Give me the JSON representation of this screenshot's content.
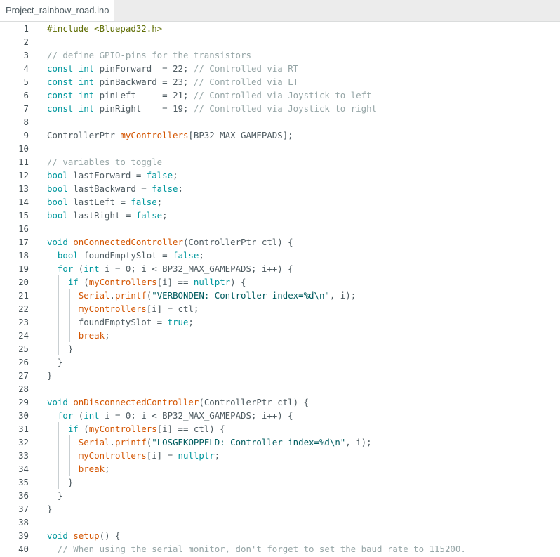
{
  "tab": {
    "filename": "Project_rainbow_road.ino"
  },
  "code": {
    "lines": [
      {
        "n": "1",
        "indent": 0,
        "tokens": [
          [
            "pp",
            "#include <Bluepad32.h>"
          ]
        ]
      },
      {
        "n": "2",
        "indent": 0,
        "tokens": []
      },
      {
        "n": "3",
        "indent": 0,
        "tokens": [
          [
            "cm",
            "// define GPIO-pins for the transistors"
          ]
        ]
      },
      {
        "n": "4",
        "indent": 0,
        "tokens": [
          [
            "kw",
            "const"
          ],
          [
            "tx",
            " "
          ],
          [
            "kw",
            "int"
          ],
          [
            "tx",
            " pinForward  = 22; "
          ],
          [
            "cm",
            "// Controlled via RT"
          ]
        ]
      },
      {
        "n": "5",
        "indent": 0,
        "tokens": [
          [
            "kw",
            "const"
          ],
          [
            "tx",
            " "
          ],
          [
            "kw",
            "int"
          ],
          [
            "tx",
            " pinBackward = 23; "
          ],
          [
            "cm",
            "// Controlled via LT"
          ]
        ]
      },
      {
        "n": "6",
        "indent": 0,
        "tokens": [
          [
            "kw",
            "const"
          ],
          [
            "tx",
            " "
          ],
          [
            "kw",
            "int"
          ],
          [
            "tx",
            " pinLeft     = 21; "
          ],
          [
            "cm",
            "// Controlled via Joystick to left"
          ]
        ]
      },
      {
        "n": "7",
        "indent": 0,
        "tokens": [
          [
            "kw",
            "const"
          ],
          [
            "tx",
            " "
          ],
          [
            "kw",
            "int"
          ],
          [
            "tx",
            " pinRight    = 19; "
          ],
          [
            "cm",
            "// Controlled via Joystick to right"
          ]
        ]
      },
      {
        "n": "8",
        "indent": 0,
        "tokens": []
      },
      {
        "n": "9",
        "indent": 0,
        "tokens": [
          [
            "tx",
            "ControllerPtr "
          ],
          [
            "fn",
            "myControllers"
          ],
          [
            "tx",
            "[BP32_MAX_GAMEPADS];"
          ]
        ]
      },
      {
        "n": "10",
        "indent": 0,
        "tokens": []
      },
      {
        "n": "11",
        "indent": 0,
        "tokens": [
          [
            "cm",
            "// variables to toggle"
          ]
        ]
      },
      {
        "n": "12",
        "indent": 0,
        "tokens": [
          [
            "kw",
            "bool"
          ],
          [
            "tx",
            " lastForward = "
          ],
          [
            "lt",
            "false"
          ],
          [
            "tx",
            ";"
          ]
        ]
      },
      {
        "n": "13",
        "indent": 0,
        "tokens": [
          [
            "kw",
            "bool"
          ],
          [
            "tx",
            " lastBackward = "
          ],
          [
            "lt",
            "false"
          ],
          [
            "tx",
            ";"
          ]
        ]
      },
      {
        "n": "14",
        "indent": 0,
        "tokens": [
          [
            "kw",
            "bool"
          ],
          [
            "tx",
            " lastLeft = "
          ],
          [
            "lt",
            "false"
          ],
          [
            "tx",
            ";"
          ]
        ]
      },
      {
        "n": "15",
        "indent": 0,
        "tokens": [
          [
            "kw",
            "bool"
          ],
          [
            "tx",
            " lastRight = "
          ],
          [
            "lt",
            "false"
          ],
          [
            "tx",
            ";"
          ]
        ]
      },
      {
        "n": "16",
        "indent": 0,
        "tokens": []
      },
      {
        "n": "17",
        "indent": 0,
        "tokens": [
          [
            "kw",
            "void"
          ],
          [
            "tx",
            " "
          ],
          [
            "fn",
            "onConnectedController"
          ],
          [
            "tx",
            "(ControllerPtr ctl) {"
          ]
        ]
      },
      {
        "n": "18",
        "indent": 1,
        "tokens": [
          [
            "tx",
            "  "
          ],
          [
            "kw",
            "bool"
          ],
          [
            "tx",
            " foundEmptySlot = "
          ],
          [
            "lt",
            "false"
          ],
          [
            "tx",
            ";"
          ]
        ]
      },
      {
        "n": "19",
        "indent": 1,
        "tokens": [
          [
            "tx",
            "  "
          ],
          [
            "kw",
            "for"
          ],
          [
            "tx",
            " ("
          ],
          [
            "kw",
            "int"
          ],
          [
            "tx",
            " i = 0; i < BP32_MAX_GAMEPADS; i++) {"
          ]
        ]
      },
      {
        "n": "20",
        "indent": 2,
        "tokens": [
          [
            "tx",
            "    "
          ],
          [
            "kw",
            "if"
          ],
          [
            "tx",
            " ("
          ],
          [
            "fn",
            "myControllers"
          ],
          [
            "tx",
            "[i] == "
          ],
          [
            "lt",
            "nullptr"
          ],
          [
            "tx",
            ") {"
          ]
        ]
      },
      {
        "n": "21",
        "indent": 3,
        "tokens": [
          [
            "tx",
            "      "
          ],
          [
            "fn",
            "Serial"
          ],
          [
            "tx",
            "."
          ],
          [
            "fn",
            "printf"
          ],
          [
            "tx",
            "("
          ],
          [
            "st",
            "\"VERBONDEN: Controller index=%d\\n\""
          ],
          [
            "tx",
            ", i);"
          ]
        ]
      },
      {
        "n": "22",
        "indent": 3,
        "tokens": [
          [
            "tx",
            "      "
          ],
          [
            "fn",
            "myControllers"
          ],
          [
            "tx",
            "[i] = ctl;"
          ]
        ]
      },
      {
        "n": "23",
        "indent": 3,
        "tokens": [
          [
            "tx",
            "      foundEmptySlot = "
          ],
          [
            "lt",
            "true"
          ],
          [
            "tx",
            ";"
          ]
        ]
      },
      {
        "n": "24",
        "indent": 3,
        "tokens": [
          [
            "tx",
            "      "
          ],
          [
            "fn",
            "break"
          ],
          [
            "tx",
            ";"
          ]
        ]
      },
      {
        "n": "25",
        "indent": 2,
        "tokens": [
          [
            "tx",
            "    }"
          ]
        ]
      },
      {
        "n": "26",
        "indent": 1,
        "tokens": [
          [
            "tx",
            "  }"
          ]
        ]
      },
      {
        "n": "27",
        "indent": 0,
        "tokens": [
          [
            "tx",
            "}"
          ]
        ]
      },
      {
        "n": "28",
        "indent": 0,
        "tokens": []
      },
      {
        "n": "29",
        "indent": 0,
        "tokens": [
          [
            "kw",
            "void"
          ],
          [
            "tx",
            " "
          ],
          [
            "fn",
            "onDisconnectedController"
          ],
          [
            "tx",
            "(ControllerPtr ctl) {"
          ]
        ]
      },
      {
        "n": "30",
        "indent": 1,
        "tokens": [
          [
            "tx",
            "  "
          ],
          [
            "kw",
            "for"
          ],
          [
            "tx",
            " ("
          ],
          [
            "kw",
            "int"
          ],
          [
            "tx",
            " i = 0; i < BP32_MAX_GAMEPADS; i++) {"
          ]
        ]
      },
      {
        "n": "31",
        "indent": 2,
        "tokens": [
          [
            "tx",
            "    "
          ],
          [
            "kw",
            "if"
          ],
          [
            "tx",
            " ("
          ],
          [
            "fn",
            "myControllers"
          ],
          [
            "tx",
            "[i] == ctl) {"
          ]
        ]
      },
      {
        "n": "32",
        "indent": 3,
        "tokens": [
          [
            "tx",
            "      "
          ],
          [
            "fn",
            "Serial"
          ],
          [
            "tx",
            "."
          ],
          [
            "fn",
            "printf"
          ],
          [
            "tx",
            "("
          ],
          [
            "st",
            "\"LOSGEKOPPELD: Controller index=%d\\n\""
          ],
          [
            "tx",
            ", i);"
          ]
        ]
      },
      {
        "n": "33",
        "indent": 3,
        "tokens": [
          [
            "tx",
            "      "
          ],
          [
            "fn",
            "myControllers"
          ],
          [
            "tx",
            "[i] = "
          ],
          [
            "lt",
            "nullptr"
          ],
          [
            "tx",
            ";"
          ]
        ]
      },
      {
        "n": "34",
        "indent": 3,
        "tokens": [
          [
            "tx",
            "      "
          ],
          [
            "fn",
            "break"
          ],
          [
            "tx",
            ";"
          ]
        ]
      },
      {
        "n": "35",
        "indent": 2,
        "tokens": [
          [
            "tx",
            "    }"
          ]
        ]
      },
      {
        "n": "36",
        "indent": 1,
        "tokens": [
          [
            "tx",
            "  }"
          ]
        ]
      },
      {
        "n": "37",
        "indent": 0,
        "tokens": [
          [
            "tx",
            "}"
          ]
        ]
      },
      {
        "n": "38",
        "indent": 0,
        "tokens": []
      },
      {
        "n": "39",
        "indent": 0,
        "tokens": [
          [
            "kw",
            "void"
          ],
          [
            "tx",
            " "
          ],
          [
            "fn",
            "setup"
          ],
          [
            "tx",
            "() {"
          ]
        ]
      },
      {
        "n": "40",
        "indent": 1,
        "tokens": [
          [
            "tx",
            "  "
          ],
          [
            "cm",
            "// When using the serial monitor, don't forget to set the baud rate to 115200."
          ]
        ]
      }
    ]
  }
}
